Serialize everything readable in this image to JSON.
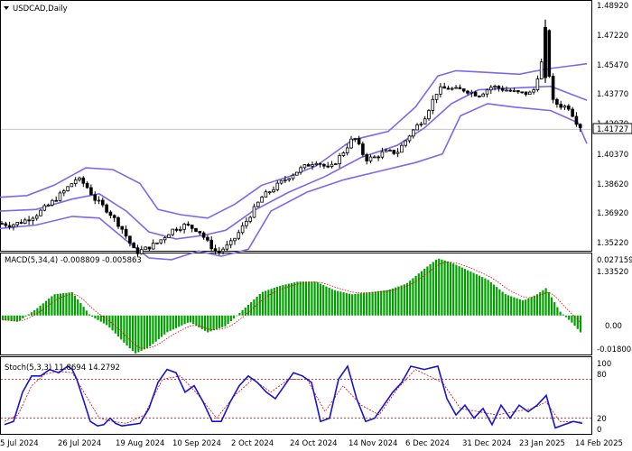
{
  "main": {
    "title": "USDCAD,Daily",
    "current_price": "1.41727",
    "price_scale_labels": [
      "1.48920",
      "1.47220",
      "1.45470",
      "1.43770",
      "1.42070",
      "1.40370",
      "1.38620",
      "1.36920",
      "1.35220",
      "1.33520"
    ]
  },
  "macd": {
    "title": "MACD(5,34,4) -0.008809 -0.005863",
    "scale_labels": [
      "0.027159",
      "0.00",
      "-0.018008"
    ]
  },
  "stoch": {
    "title": "Stoch(5,3,3) 11.8694 14.2792",
    "scale_labels": [
      "100",
      "80",
      "20",
      "0"
    ]
  },
  "time_labels": [
    "5 Jul 2024",
    "26 Jul 2024",
    "19 Aug 2024",
    "10 Sep 2024",
    "2 Oct 2024",
    "24 Oct 2024",
    "14 Nov 2024",
    "6 Dec 2024",
    "31 Dec 2024",
    "23 Jan 2025",
    "14 Feb 2025"
  ],
  "chart_data": {
    "type": "candlestick",
    "symbol": "USDCAD",
    "timeframe": "Daily",
    "y_range": [
      1.3352,
      1.4892
    ],
    "last_price": 1.41727,
    "close_path": [
      [
        0,
        1.363
      ],
      [
        12,
        1.362
      ],
      [
        25,
        1.364
      ],
      [
        40,
        1.368
      ],
      [
        55,
        1.374
      ],
      [
        70,
        1.381
      ],
      [
        85,
        1.389
      ],
      [
        95,
        1.385
      ],
      [
        105,
        1.377
      ],
      [
        120,
        1.37
      ],
      [
        135,
        1.36
      ],
      [
        150,
        1.346
      ],
      [
        160,
        1.348
      ],
      [
        175,
        1.352
      ],
      [
        190,
        1.359
      ],
      [
        205,
        1.362
      ],
      [
        220,
        1.359
      ],
      [
        230,
        1.352
      ],
      [
        240,
        1.346
      ],
      [
        255,
        1.351
      ],
      [
        265,
        1.358
      ],
      [
        275,
        1.366
      ],
      [
        290,
        1.378
      ],
      [
        305,
        1.384
      ],
      [
        320,
        1.39
      ],
      [
        335,
        1.395
      ],
      [
        350,
        1.399
      ],
      [
        365,
        1.394
      ],
      [
        380,
        1.404
      ],
      [
        392,
        1.413
      ],
      [
        405,
        1.4
      ],
      [
        415,
        1.401
      ],
      [
        425,
        1.404
      ],
      [
        440,
        1.404
      ],
      [
        455,
        1.415
      ],
      [
        470,
        1.424
      ],
      [
        485,
        1.44
      ],
      [
        495,
        1.441
      ],
      [
        505,
        1.44
      ],
      [
        515,
        1.44
      ],
      [
        530,
        1.437
      ],
      [
        545,
        1.442
      ],
      [
        560,
        1.44
      ],
      [
        575,
        1.438
      ],
      [
        590,
        1.438
      ],
      [
        600,
        1.456
      ],
      [
        605,
        1.477
      ],
      [
        610,
        1.434
      ],
      [
        620,
        1.431
      ],
      [
        630,
        1.43
      ],
      [
        640,
        1.42
      ],
      [
        645,
        1.418
      ]
    ],
    "bollinger": {
      "upper": [
        [
          0,
          1.378
        ],
        [
          30,
          1.379
        ],
        [
          60,
          1.385
        ],
        [
          95,
          1.395
        ],
        [
          125,
          1.394
        ],
        [
          155,
          1.386
        ],
        [
          175,
          1.371
        ],
        [
          200,
          1.368
        ],
        [
          230,
          1.366
        ],
        [
          260,
          1.374
        ],
        [
          290,
          1.385
        ],
        [
          320,
          1.39
        ],
        [
          350,
          1.396
        ],
        [
          390,
          1.411
        ],
        [
          430,
          1.416
        ],
        [
          460,
          1.43
        ],
        [
          485,
          1.448
        ],
        [
          505,
          1.451
        ],
        [
          540,
          1.45
        ],
        [
          575,
          1.449
        ],
        [
          605,
          1.452
        ],
        [
          650,
          1.455
        ]
      ],
      "middle": [
        [
          0,
          1.37
        ],
        [
          40,
          1.371
        ],
        [
          80,
          1.377
        ],
        [
          110,
          1.38
        ],
        [
          140,
          1.37
        ],
        [
          165,
          1.358
        ],
        [
          195,
          1.354
        ],
        [
          225,
          1.356
        ],
        [
          250,
          1.359
        ],
        [
          280,
          1.37
        ],
        [
          320,
          1.381
        ],
        [
          360,
          1.39
        ],
        [
          400,
          1.401
        ],
        [
          440,
          1.408
        ],
        [
          470,
          1.418
        ],
        [
          500,
          1.432
        ],
        [
          530,
          1.44
        ],
        [
          570,
          1.441
        ],
        [
          610,
          1.442
        ],
        [
          650,
          1.434
        ]
      ],
      "lower": [
        [
          0,
          1.36
        ],
        [
          40,
          1.362
        ],
        [
          80,
          1.367
        ],
        [
          110,
          1.366
        ],
        [
          140,
          1.353
        ],
        [
          165,
          1.343
        ],
        [
          190,
          1.342
        ],
        [
          220,
          1.347
        ],
        [
          245,
          1.344
        ],
        [
          275,
          1.348
        ],
        [
          300,
          1.37
        ],
        [
          340,
          1.381
        ],
        [
          380,
          1.388
        ],
        [
          420,
          1.393
        ],
        [
          460,
          1.398
        ],
        [
          490,
          1.403
        ],
        [
          510,
          1.425
        ],
        [
          540,
          1.432
        ],
        [
          570,
          1.43
        ],
        [
          610,
          1.428
        ],
        [
          640,
          1.421
        ],
        [
          650,
          1.409
        ]
      ]
    },
    "macd_histogram": [
      [
        0,
        -0.002
      ],
      [
        20,
        -0.003
      ],
      [
        40,
        0.003
      ],
      [
        60,
        0.01
      ],
      [
        80,
        0.011
      ],
      [
        100,
        0.0
      ],
      [
        120,
        -0.005
      ],
      [
        140,
        -0.014
      ],
      [
        150,
        -0.018
      ],
      [
        165,
        -0.015
      ],
      [
        185,
        -0.008
      ],
      [
        210,
        -0.003
      ],
      [
        230,
        -0.008
      ],
      [
        250,
        -0.005
      ],
      [
        270,
        0.003
      ],
      [
        290,
        0.011
      ],
      [
        310,
        0.014
      ],
      [
        330,
        0.016
      ],
      [
        350,
        0.016
      ],
      [
        370,
        0.012
      ],
      [
        390,
        0.01
      ],
      [
        410,
        0.011
      ],
      [
        430,
        0.012
      ],
      [
        450,
        0.015
      ],
      [
        470,
        0.022
      ],
      [
        485,
        0.027
      ],
      [
        500,
        0.025
      ],
      [
        520,
        0.021
      ],
      [
        540,
        0.017
      ],
      [
        560,
        0.01
      ],
      [
        580,
        0.007
      ],
      [
        595,
        0.01
      ],
      [
        605,
        0.013
      ],
      [
        620,
        0.002
      ],
      [
        635,
        -0.004
      ],
      [
        645,
        -0.009
      ]
    ],
    "stoch_main": [
      [
        5,
        10
      ],
      [
        15,
        15
      ],
      [
        25,
        60
      ],
      [
        35,
        85
      ],
      [
        45,
        85
      ],
      [
        55,
        95
      ],
      [
        65,
        90
      ],
      [
        75,
        100
      ],
      [
        80,
        95
      ],
      [
        85,
        80
      ],
      [
        92,
        50
      ],
      [
        100,
        15
      ],
      [
        108,
        8
      ],
      [
        115,
        10
      ],
      [
        122,
        20
      ],
      [
        128,
        12
      ],
      [
        135,
        8
      ],
      [
        145,
        10
      ],
      [
        155,
        12
      ],
      [
        165,
        35
      ],
      [
        175,
        75
      ],
      [
        185,
        95
      ],
      [
        195,
        90
      ],
      [
        205,
        60
      ],
      [
        215,
        70
      ],
      [
        225,
        45
      ],
      [
        235,
        15
      ],
      [
        245,
        15
      ],
      [
        255,
        45
      ],
      [
        265,
        70
      ],
      [
        275,
        85
      ],
      [
        285,
        75
      ],
      [
        295,
        60
      ],
      [
        305,
        50
      ],
      [
        315,
        70
      ],
      [
        325,
        90
      ],
      [
        335,
        85
      ],
      [
        345,
        75
      ],
      [
        355,
        15
      ],
      [
        365,
        20
      ],
      [
        375,
        80
      ],
      [
        385,
        100
      ],
      [
        395,
        50
      ],
      [
        405,
        15
      ],
      [
        415,
        20
      ],
      [
        425,
        40
      ],
      [
        435,
        60
      ],
      [
        445,
        75
      ],
      [
        455,
        100
      ],
      [
        470,
        95
      ],
      [
        485,
        100
      ],
      [
        495,
        50
      ],
      [
        505,
        25
      ],
      [
        515,
        40
      ],
      [
        525,
        20
      ],
      [
        535,
        35
      ],
      [
        545,
        10
      ],
      [
        555,
        40
      ],
      [
        565,
        20
      ],
      [
        575,
        40
      ],
      [
        585,
        30
      ],
      [
        595,
        40
      ],
      [
        605,
        55
      ],
      [
        615,
        5
      ],
      [
        625,
        10
      ],
      [
        635,
        15
      ],
      [
        645,
        12
      ]
    ],
    "stoch_signal": [
      [
        5,
        15
      ],
      [
        20,
        25
      ],
      [
        35,
        70
      ],
      [
        50,
        88
      ],
      [
        65,
        92
      ],
      [
        80,
        90
      ],
      [
        95,
        55
      ],
      [
        110,
        20
      ],
      [
        125,
        15
      ],
      [
        140,
        12
      ],
      [
        160,
        25
      ],
      [
        180,
        80
      ],
      [
        200,
        85
      ],
      [
        220,
        55
      ],
      [
        240,
        20
      ],
      [
        260,
        55
      ],
      [
        280,
        80
      ],
      [
        300,
        60
      ],
      [
        320,
        80
      ],
      [
        340,
        80
      ],
      [
        360,
        30
      ],
      [
        380,
        70
      ],
      [
        400,
        40
      ],
      [
        420,
        25
      ],
      [
        440,
        65
      ],
      [
        460,
        95
      ],
      [
        490,
        75
      ],
      [
        510,
        35
      ],
      [
        530,
        30
      ],
      [
        550,
        25
      ],
      [
        570,
        30
      ],
      [
        590,
        35
      ],
      [
        605,
        45
      ],
      [
        620,
        15
      ],
      [
        645,
        14
      ]
    ],
    "stoch_levels": [
      80,
      20
    ]
  }
}
